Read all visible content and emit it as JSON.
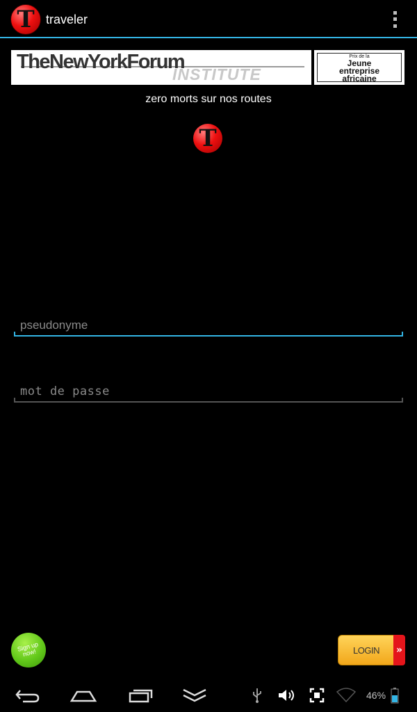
{
  "app": {
    "title": "traveler",
    "logo_letter": "T"
  },
  "banner": {
    "brand": "TheNewYorkForum",
    "sub": "INSTITUTE",
    "prize_line": "Prix de la",
    "prize_name_1": "Jeune",
    "prize_name_2": "entreprise",
    "prize_name_3": "africaine"
  },
  "tagline": "zero morts sur nos routes",
  "form": {
    "username_placeholder": "pseudonyme",
    "password_placeholder": "mot de passe"
  },
  "buttons": {
    "signup_label": "Sign up\nnow!",
    "login_label": "LOGIN"
  },
  "statusbar": {
    "battery": "46%"
  },
  "colors": {
    "accent": "#33b5e5",
    "logo_red": "#ee1010",
    "signup_green": "#62c81a",
    "login_yellow": "#f2a71a",
    "login_red": "#e4151b"
  },
  "icons": [
    "overflow-menu-icon",
    "back-icon",
    "home-icon",
    "recents-icon",
    "hide-keyboard-icon",
    "usb-icon",
    "volume-icon",
    "screenshot-icon",
    "wifi-icon",
    "battery-icon"
  ]
}
